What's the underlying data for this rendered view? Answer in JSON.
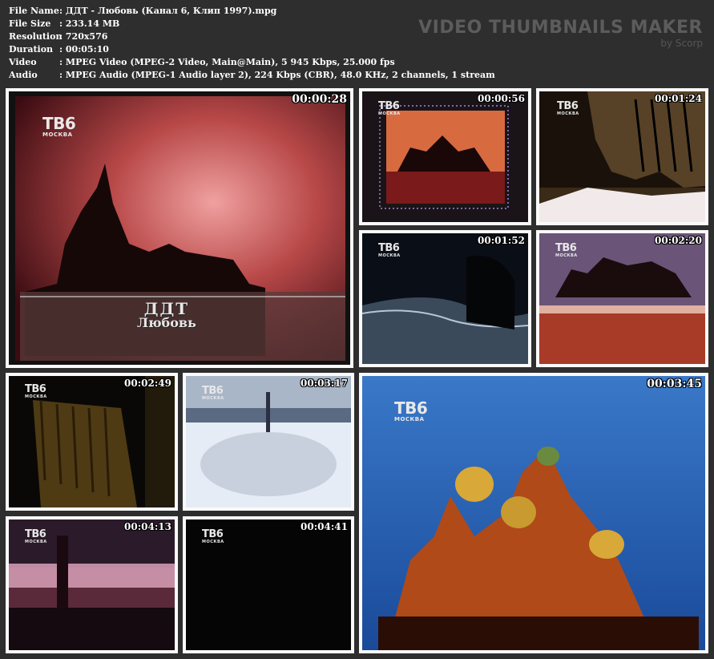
{
  "info": [
    {
      "label": "File Name",
      "value": "ДДТ - Любовь (Канал 6, Клип 1997).mpg"
    },
    {
      "label": "File Size",
      "value": "233.14 MB"
    },
    {
      "label": "Resolution",
      "value": "720x576"
    },
    {
      "label": "Duration",
      "value": "00:05:10"
    },
    {
      "label": "Video",
      "value": "MPEG Video (MPEG-2 Video, Main@Main), 5 945 Kbps, 25.000 fps"
    },
    {
      "label": "Audio",
      "value": "MPEG Audio (MPEG-1 Audio layer 2), 224 Kbps (CBR), 48.0 KHz, 2 channels, 1 stream"
    }
  ],
  "brand": {
    "title": "VIDEO THUMBNAILS MAKER",
    "subtitle": "by Scorp"
  },
  "logo": {
    "main": "ТВ6",
    "sub": "МОСКВА"
  },
  "caption": {
    "line1": "ДДТ",
    "line2": "Любовь"
  },
  "thumbnails": [
    {
      "time": "00:00:28"
    },
    {
      "time": "00:00:56"
    },
    {
      "time": "00:01:24"
    },
    {
      "time": "00:01:52"
    },
    {
      "time": "00:02:20"
    },
    {
      "time": "00:02:49"
    },
    {
      "time": "00:03:17"
    },
    {
      "time": "00:03:45"
    },
    {
      "time": "00:04:13"
    },
    {
      "time": "00:04:41"
    }
  ]
}
